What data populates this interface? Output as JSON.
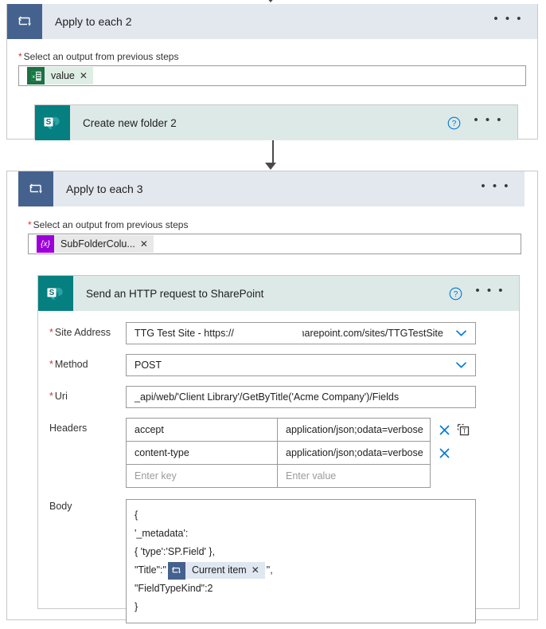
{
  "flow": {
    "scope_outer": {
      "title": "Apply to each 2",
      "icon": "loop-icon",
      "more_label": "• • •",
      "input_label": "Select an output from previous steps",
      "required_marker": "*",
      "token": {
        "label": "value",
        "icon": "excel-icon",
        "remove_label": "✕"
      },
      "child_action": {
        "title": "Create new folder 2",
        "icon": "sharepoint-icon",
        "help_label": "?",
        "more_label": "• • •"
      }
    },
    "scope_inner": {
      "title": "Apply to each 3",
      "icon": "loop-icon",
      "more_label": "• • •",
      "input_label": "Select an output from previous steps",
      "required_marker": "*",
      "token": {
        "label": "SubFolderColu...",
        "icon": "variable-icon",
        "remove_label": "✕"
      }
    },
    "http_action": {
      "title": "Send an HTTP request to SharePoint",
      "icon": "sharepoint-icon",
      "help_label": "?",
      "more_label": "• • •",
      "fields": {
        "site_address": {
          "label": "Site Address",
          "required": true,
          "value_prefix": "TTG Test Site - https://",
          "value_suffix": ".sharepoint.com/sites/TTGTestSite",
          "chevron": "chevron-down-icon"
        },
        "method": {
          "label": "Method",
          "required": true,
          "value": "POST",
          "chevron": "chevron-down-icon"
        },
        "uri": {
          "label": "Uri",
          "required": true,
          "value": "_api/web/'Client Library'/GetByTitle('Acme Company')/Fields"
        },
        "headers": {
          "label": "Headers",
          "required": false,
          "rows": [
            {
              "key": "accept",
              "value": "application/json;odata=verbose",
              "remove_label": "✕",
              "has_text_mode": true
            },
            {
              "key": "content-type",
              "value": "application/json;odata=verbose",
              "remove_label": "✕",
              "has_text_mode": false
            }
          ],
          "key_placeholder": "Enter key",
          "value_placeholder": "Enter value"
        },
        "body": {
          "label": "Body",
          "required": false,
          "lines": [
            {
              "text": "{"
            },
            {
              "text": "'_metadata':"
            },
            {
              "text": "{ 'type':'SP.Field' },"
            },
            {
              "prefix": "\"Title\":\"",
              "token": {
                "label": "Current item",
                "icon": "loop-icon",
                "remove_label": "✕"
              },
              "suffix": "\","
            },
            {
              "text": "\"FieldTypeKind\":2"
            },
            {
              "text": "}"
            }
          ]
        }
      }
    }
  },
  "colors": {
    "scope_header_bg": "#e3e8ef",
    "scope_icon_bg": "#45628f",
    "action_header_bg": "#dce9e7",
    "sharepoint_icon_bg": "#057f7f",
    "excel_icon_bg": "#1d7044",
    "variable_icon_bg": "#9b00d8",
    "required_star": "#d13438",
    "accent_blue": "#0078d4",
    "connector": "#4a4a4a"
  }
}
